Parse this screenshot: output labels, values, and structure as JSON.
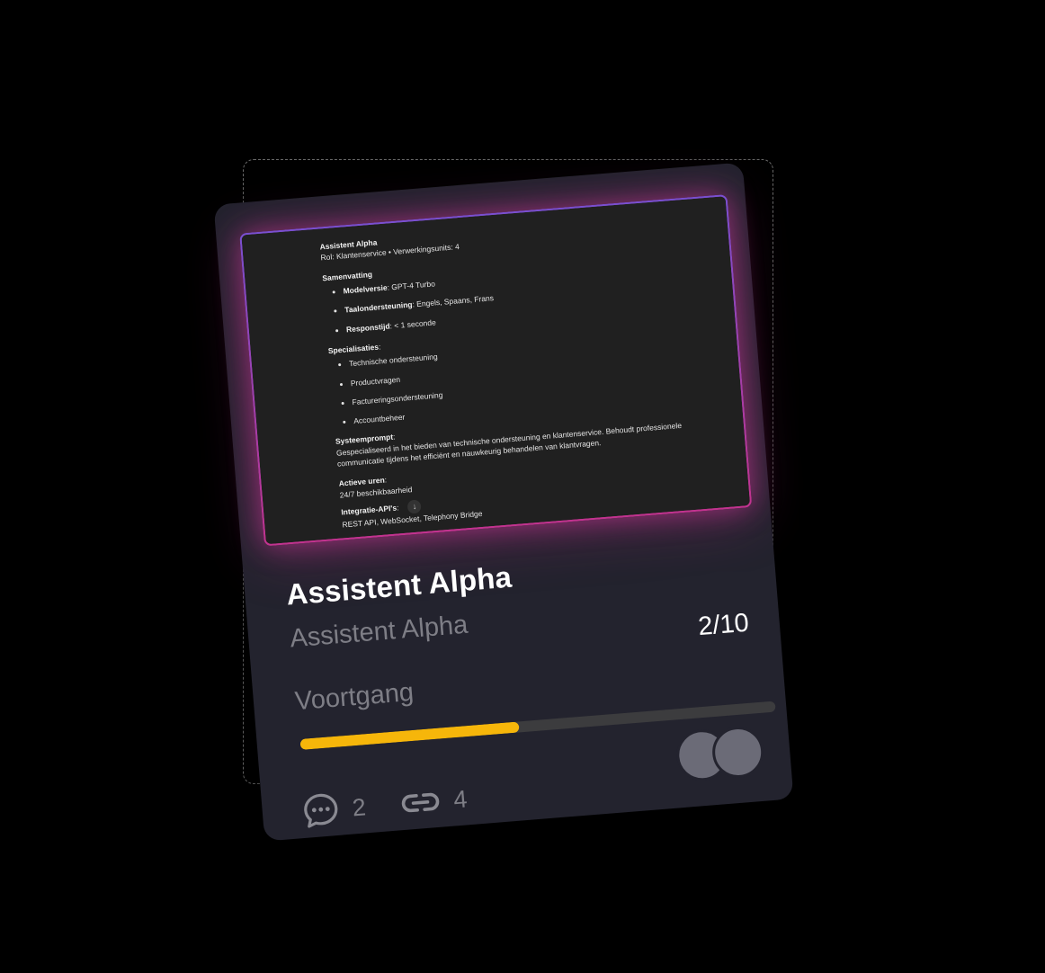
{
  "preview": {
    "heading": "Assistent Alpha",
    "role_line": "Rol: Klantenservice • Verwerkingsunits: 4",
    "summary_title": "Samenvatting",
    "summary_items": [
      {
        "label": "Modelversie",
        "value": ": GPT-4 Turbo"
      },
      {
        "label": "Taalondersteuning",
        "value": ": Engels, Spaans, Frans"
      },
      {
        "label": "Responstijd",
        "value": ": < 1 seconde"
      }
    ],
    "specializations_title": "Specialisaties",
    "specializations": [
      "Technische ondersteuning",
      "Productvragen",
      "Factureringsondersteuning",
      "Accountbeheer"
    ],
    "system_prompt_title": "Systeemprompt",
    "system_prompt_text": "Gespecialiseerd in het bieden van technische ondersteuning en klantenservice. Behoudt professionele communicatie tijdens het efficiënt en nauwkeurig behandelen van klantvragen.",
    "active_hours_title": "Actieve uren",
    "active_hours_value": "24/7 beschikbaarheid",
    "integration_title": "Integratie-API's",
    "integration_value": "REST API, WebSocket, Telephony Bridge"
  },
  "card": {
    "title": "Assistent Alpha",
    "subtitle": "Assistent Alpha",
    "progress_label": "Voortgang",
    "progress_count": "2/10",
    "progress_fraction": 0.46,
    "comments_count": "2",
    "links_count": "4"
  },
  "colors": {
    "card_bg": "#23232e",
    "progress_fill": "#f6b60a",
    "glow_start": "#7a4fd0",
    "glow_end": "#c2338f"
  },
  "icons": {
    "comments": "chat-bubble-dots-icon",
    "links": "link-icon",
    "scroll": "arrow-down-icon"
  }
}
